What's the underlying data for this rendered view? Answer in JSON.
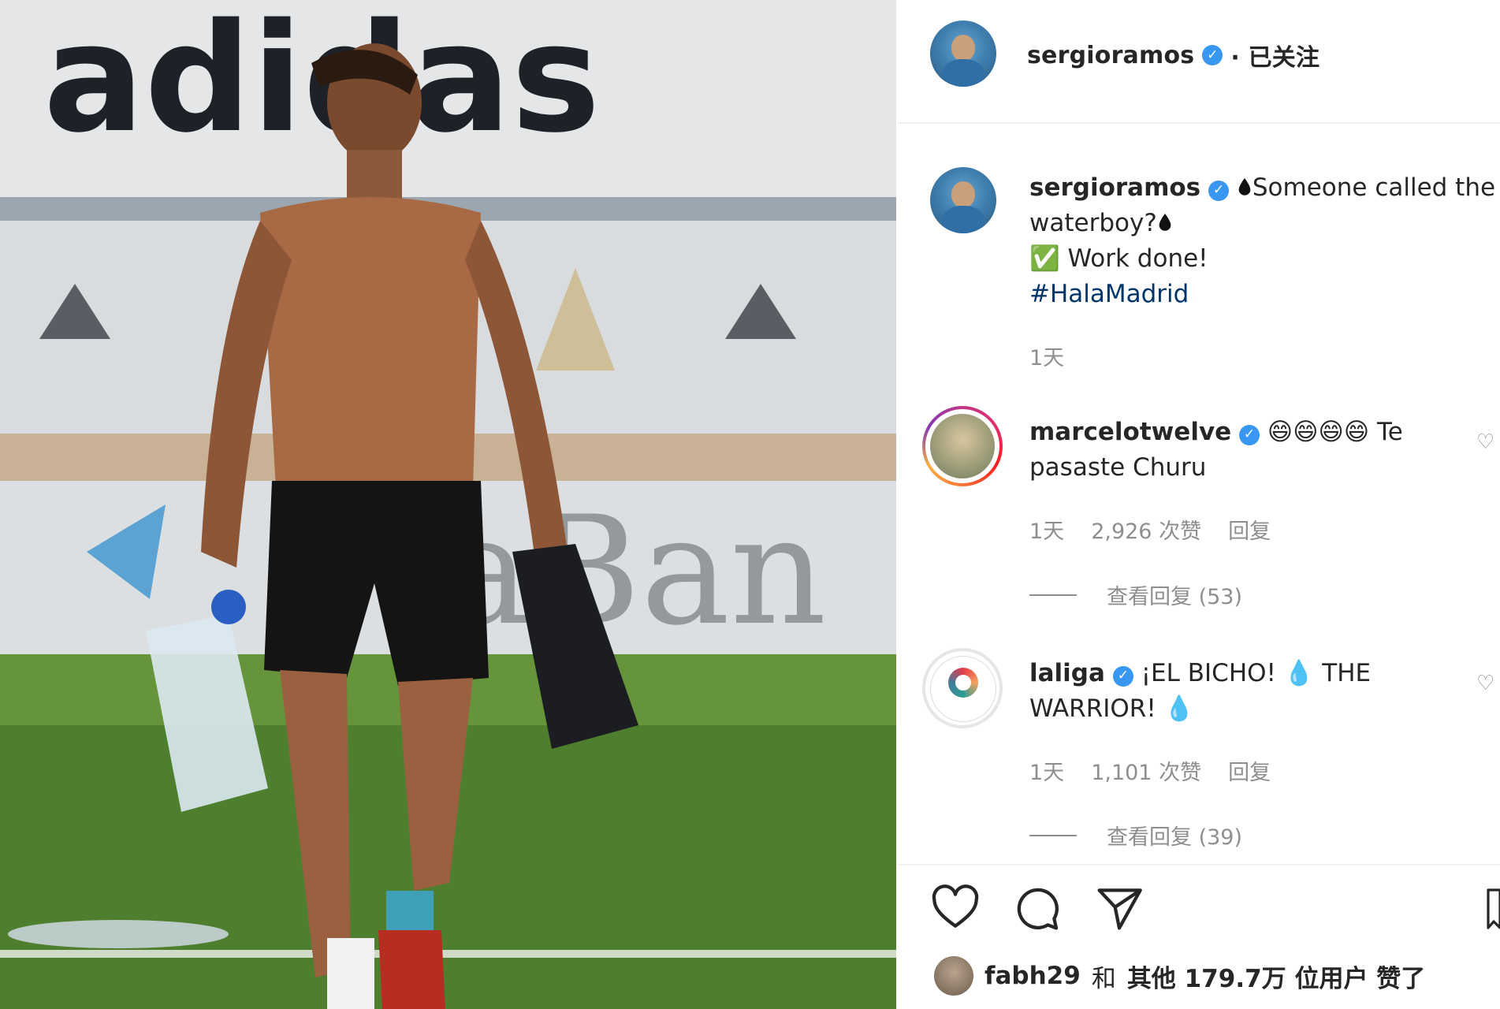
{
  "post": {
    "photo_description_text": {
      "banner_word": "adidas",
      "sponsor_word": "aBan"
    },
    "header": {
      "username": "sergioramos",
      "follow_status": "· 已关注"
    },
    "caption": {
      "username": "sergioramos",
      "line1": "Someone called the",
      "line2": "waterboy?",
      "line3": "✅ Work done!",
      "hashtag": "#HalaMadrid",
      "time": "1天"
    },
    "comments": [
      {
        "username": "marcelotwelve",
        "text_line1": "😄😄😄😄 Te",
        "text_line2": "pasaste Churu",
        "time": "1天",
        "likes": "2,926 次赞",
        "reply_label": "回复",
        "view_replies": "查看回复 (53)"
      },
      {
        "username": "laliga",
        "text_line1": "¡EL BICHO! 💧 THE",
        "text_line2": "WARRIOR! 💧",
        "time": "1天",
        "likes": "1,101 次赞",
        "reply_label": "回复",
        "view_replies": "查看回复 (39)"
      }
    ],
    "likes_summary": {
      "user": "fabh29",
      "connector": "和",
      "rest": "其他 179.7万 位用户 赞了"
    }
  },
  "colors": {
    "verified": "#3897f0",
    "hashtag": "#003569",
    "muted": "#8e8e8e",
    "text": "#262626"
  },
  "icons": [
    "verified-badge-icon",
    "water-drop-icon",
    "heart-icon",
    "comment-icon",
    "share-icon",
    "bookmark-icon"
  ]
}
